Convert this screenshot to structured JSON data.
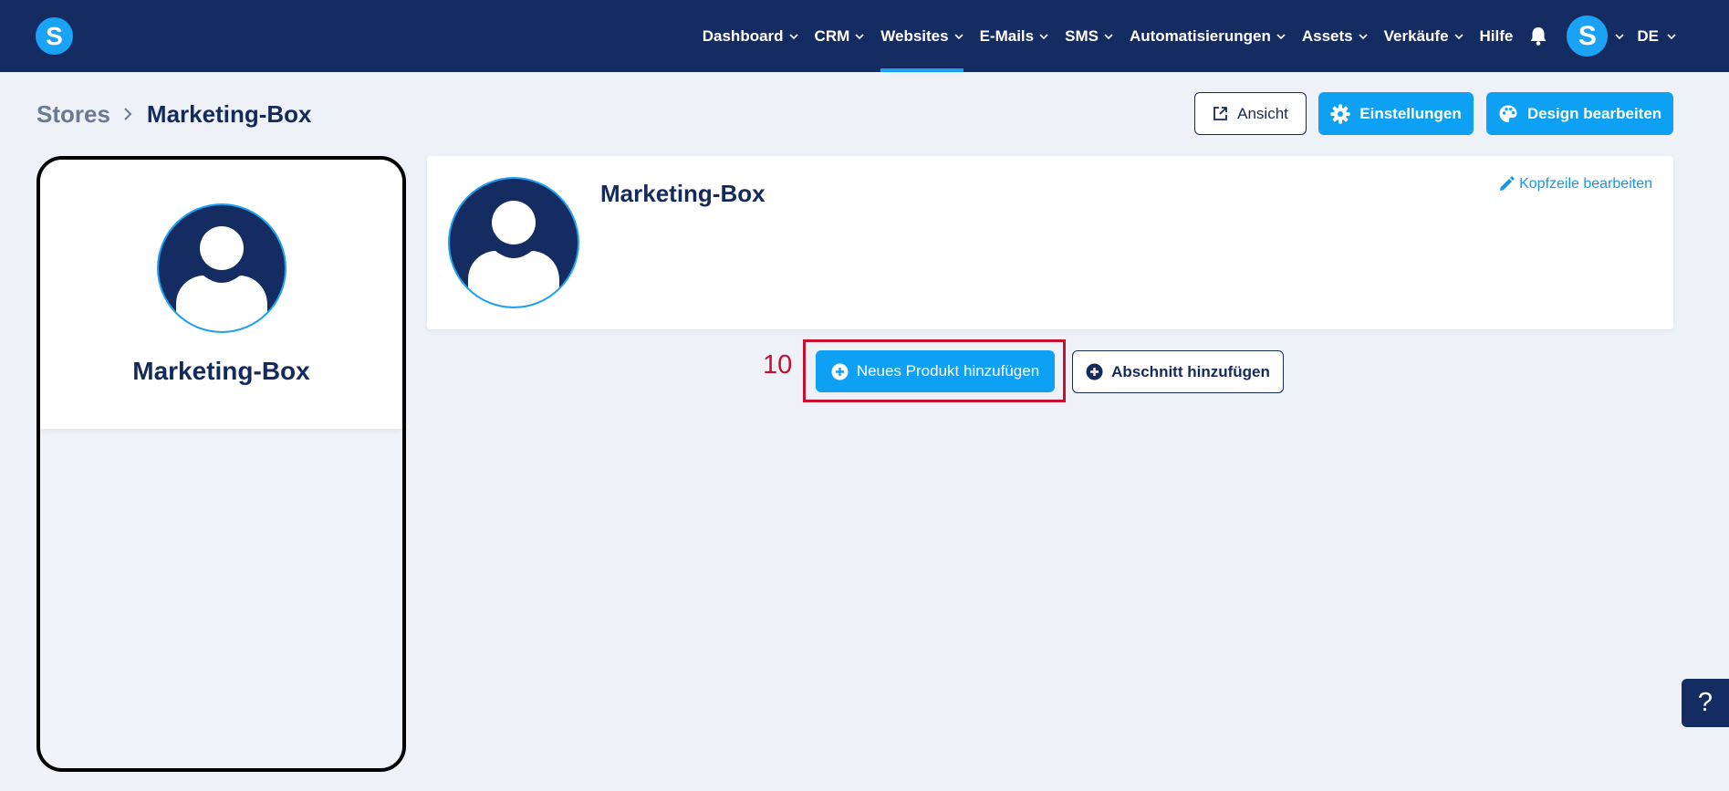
{
  "brand": {
    "logo_letter": "S",
    "accent": "#1aa3f4",
    "navy": "#152c62"
  },
  "nav": {
    "items": [
      {
        "label": "Dashboard"
      },
      {
        "label": "CRM"
      },
      {
        "label": "Websites"
      },
      {
        "label": "E-Mails"
      },
      {
        "label": "SMS"
      },
      {
        "label": "Automatisierungen"
      },
      {
        "label": "Assets"
      },
      {
        "label": "Verkäufe"
      }
    ],
    "help_label": "Hilfe",
    "notifications_icon": "bell-icon",
    "avatar_letter": "S",
    "language": "DE",
    "active_item": "Websites"
  },
  "breadcrumb": {
    "root": "Stores",
    "current": "Marketing-Box"
  },
  "actions": {
    "view_label": "Ansicht",
    "settings_label": "Einstellungen",
    "design_label": "Design bearbeiten"
  },
  "preview": {
    "store_name": "Marketing-Box"
  },
  "store_header": {
    "title": "Marketing-Box",
    "edit_label": "Kopfzeile bearbeiten"
  },
  "buttons": {
    "add_product_label": "Neues Produkt hinzufügen",
    "add_section_label": "Abschnitt hinzufügen"
  },
  "annotation": {
    "step_number": "10",
    "highlight_color": "#c8102e"
  },
  "help_tab": {
    "label": "?"
  }
}
